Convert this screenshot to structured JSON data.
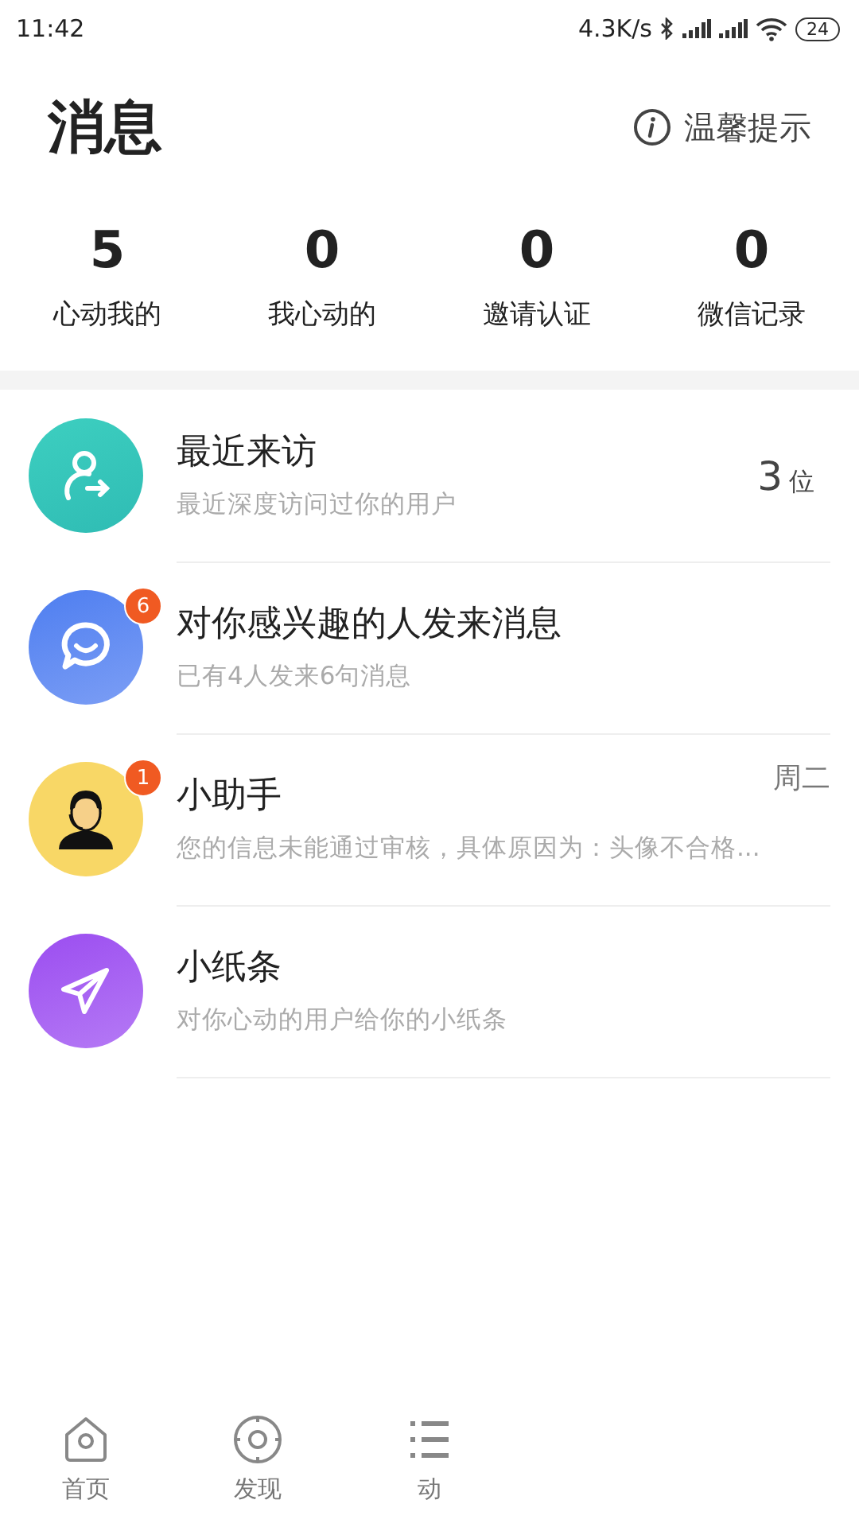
{
  "status_bar": {
    "time": "11:42",
    "speed": "4.3K/s",
    "battery": "24"
  },
  "header": {
    "title": "消息",
    "tip": "温馨提示"
  },
  "stats": [
    {
      "value": "5",
      "label": "心动我的"
    },
    {
      "value": "0",
      "label": "我心动的"
    },
    {
      "value": "0",
      "label": "邀请认证"
    },
    {
      "value": "0",
      "label": "微信记录"
    }
  ],
  "messages": [
    {
      "kind": "visitors",
      "title": "最近来访",
      "subtitle": "最近深度访问过你的用户",
      "count": "3",
      "unit": "位"
    },
    {
      "kind": "chat",
      "title": "对你感兴趣的人发来消息",
      "subtitle": "已有4人发来6句消息",
      "badge": "6"
    },
    {
      "kind": "assistant",
      "title": "小助手",
      "subtitle": "您的信息未能通过审核，具体原因为：头像不合格...",
      "time": "周二",
      "badge": "1"
    },
    {
      "kind": "note",
      "title": "小纸条",
      "subtitle": "对你心动的用户给你的小纸条"
    }
  ],
  "tab_bar": [
    {
      "kind": "home",
      "label": "首页"
    },
    {
      "kind": "discover",
      "label": "发现"
    },
    {
      "kind": "feed",
      "label": "动"
    }
  ]
}
